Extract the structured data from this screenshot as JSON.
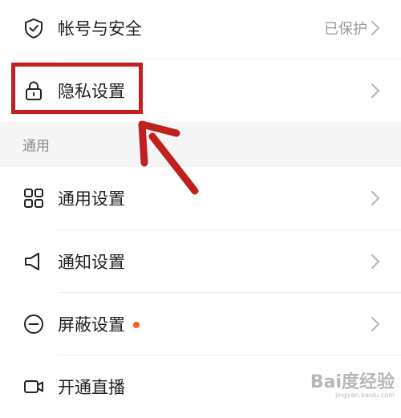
{
  "settings": {
    "rows": [
      {
        "label": "帐号与安全",
        "value": "已保护",
        "icon": "shield-check-icon"
      },
      {
        "label": "隐私设置",
        "icon": "lock-icon"
      }
    ],
    "section_general": "通用",
    "general_rows": [
      {
        "label": "通用设置",
        "icon": "grid-icon"
      },
      {
        "label": "通知设置",
        "icon": "speaker-icon"
      },
      {
        "label": "屏蔽设置",
        "icon": "block-icon",
        "badge": true
      },
      {
        "label": "开通直播",
        "icon": "video-camera-icon"
      }
    ]
  },
  "colors": {
    "highlight": "#c21f1f",
    "badge": "#ff5a1f",
    "section_bg": "#f5f5f5"
  },
  "watermark": {
    "main": "Bai度经验",
    "sub": "jingyan.baidu.com"
  }
}
